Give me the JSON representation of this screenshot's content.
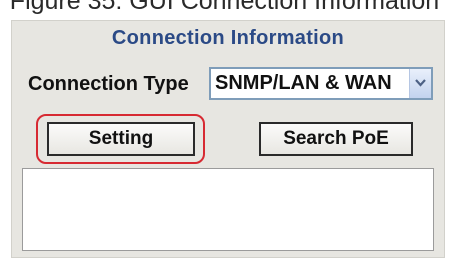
{
  "caption": "Figure 35: GUI Connection Information",
  "panel": {
    "title": "Connection Information",
    "connection_type_label": "Connection Type",
    "connection_type_value": "SNMP/LAN & WAN",
    "setting_button": "Setting",
    "search_poe_button": "Search PoE",
    "output_text": ""
  },
  "colors": {
    "title": "#2b4a86",
    "panel_bg": "#e7e6e1",
    "highlight": "#d72a32"
  }
}
